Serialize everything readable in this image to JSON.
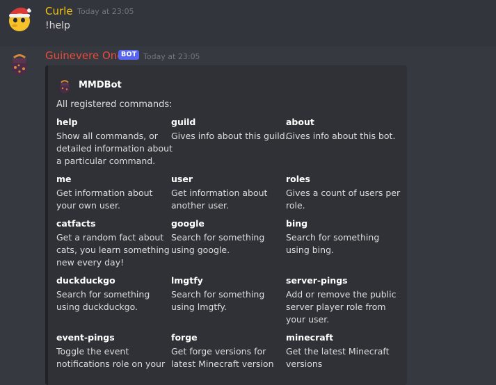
{
  "messages": [
    {
      "author": "Curle",
      "author_color": "#f1c40f",
      "timestamp": "Today at 23:05",
      "content": "!help",
      "avatar": "duck-santa-hat-avatar"
    },
    {
      "author": "Guinevere One",
      "author_color": "#e74c3c",
      "bot_tag": "BOT",
      "timestamp": "Today at 23:05",
      "avatar": "bot-bag-avatar",
      "embed": {
        "author_name": "MMDBot",
        "description": "All registered commands:",
        "fields": [
          {
            "name": "help",
            "value": [
              "Show all commands, or",
              "detailed information about",
              "a particular command."
            ]
          },
          {
            "name": "guild",
            "value": [
              "Gives info about this guild."
            ]
          },
          {
            "name": "about",
            "value": [
              "Gives info about this bot."
            ]
          },
          {
            "name": "me",
            "value": [
              "Get information about",
              "your own user."
            ]
          },
          {
            "name": "user",
            "value": [
              "Get information about",
              "another user."
            ]
          },
          {
            "name": "roles",
            "value": [
              "Gives a count of users per",
              "role."
            ]
          },
          {
            "name": "catfacts",
            "value": [
              "Get a random fact about",
              "cats, you learn something",
              "new every day!"
            ]
          },
          {
            "name": "google",
            "value": [
              "Search for something",
              "using google."
            ]
          },
          {
            "name": "bing",
            "value": [
              "Search for something",
              "using bing."
            ]
          },
          {
            "name": "duckduckgo",
            "value": [
              "Search for something",
              "using duckduckgo."
            ]
          },
          {
            "name": "lmgtfy",
            "value": [
              "Search for something",
              "using lmgtfy."
            ]
          },
          {
            "name": "server-pings",
            "value": [
              "Add or remove the public",
              "server player role from",
              "your user."
            ]
          },
          {
            "name": "event-pings",
            "value": [
              "Toggle the event",
              "notifications role on your"
            ]
          },
          {
            "name": "forge",
            "value": [
              "Get forge versions for",
              "latest Minecraft version"
            ]
          },
          {
            "name": "minecraft",
            "value": [
              "Get the latest Minecraft",
              "versions"
            ]
          }
        ]
      }
    }
  ]
}
